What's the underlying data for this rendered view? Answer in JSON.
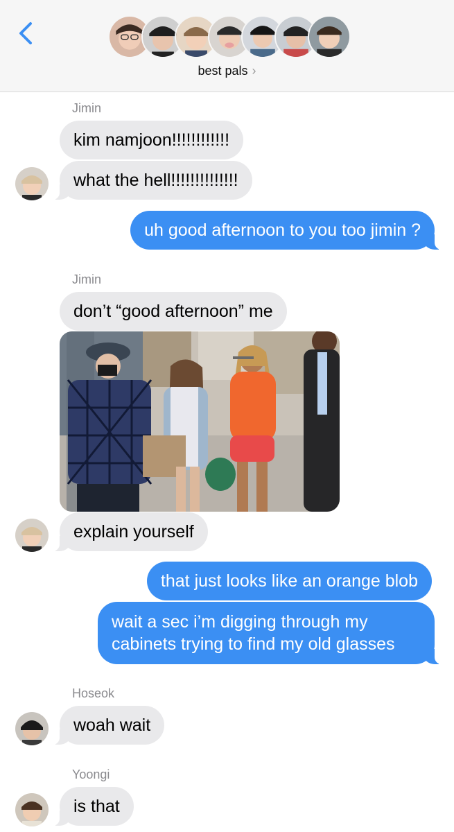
{
  "header": {
    "back_icon": "chevron-left-icon",
    "group_name": "best pals",
    "chevron": "›",
    "accent": "#3b8ff3",
    "member_avatars": [
      "avatar-1",
      "avatar-2",
      "avatar-3",
      "avatar-4",
      "avatar-5",
      "avatar-6",
      "avatar-7"
    ]
  },
  "messages": [
    {
      "sender": "Jimin"
    },
    {
      "dir": "in",
      "text": "kim namjoon!!!!!!!!!!!!"
    },
    {
      "dir": "in",
      "text": "what the hell!!!!!!!!!!!!!!"
    },
    {
      "dir": "out",
      "text": "uh good afternoon to you too jimin ?"
    },
    {
      "sender": "Jimin"
    },
    {
      "dir": "in",
      "text": "don’t “good afternoon” me"
    },
    {
      "dir": "in",
      "type": "photo"
    },
    {
      "dir": "in",
      "text": "explain yourself"
    },
    {
      "dir": "out",
      "text": "that just looks like an orange blob"
    },
    {
      "dir": "out",
      "text_lines": [
        "wait a sec i’m digging through my",
        "cabinets trying to find my old glasses"
      ]
    },
    {
      "sender": "Hoseok"
    },
    {
      "dir": "in",
      "text": "woah wait"
    },
    {
      "sender": "Yoongi"
    },
    {
      "dir": "in",
      "text": "is that"
    }
  ],
  "colors": {
    "incoming_bubble": "#e9e9eb",
    "outgoing_bubble": "#3b8ff3",
    "header_bg": "#f6f6f6"
  }
}
